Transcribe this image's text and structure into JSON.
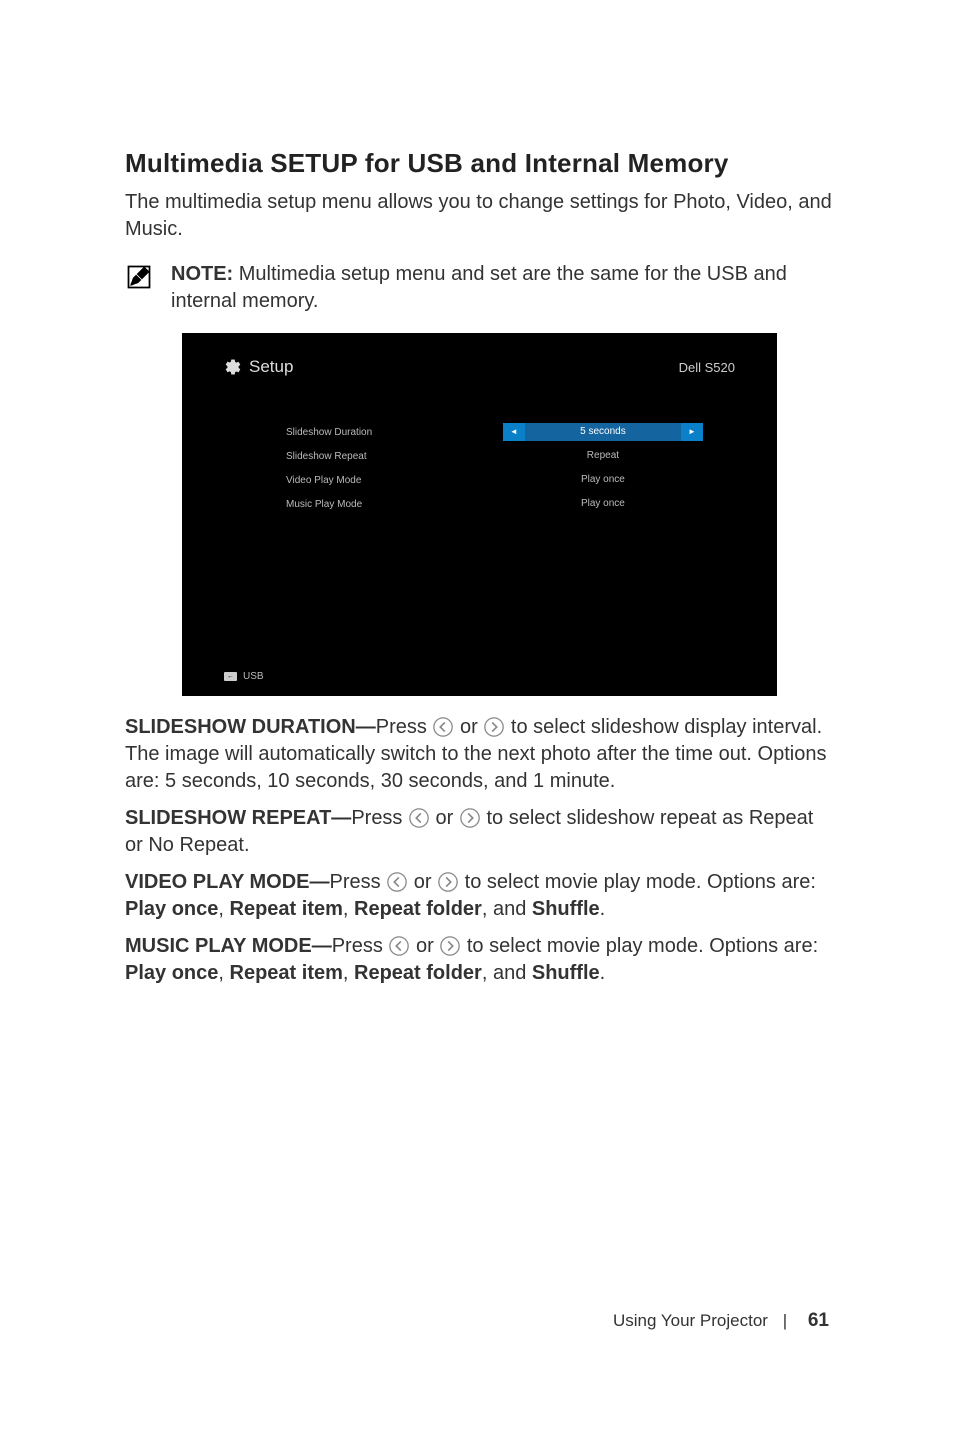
{
  "heading": "Multimedia SETUP for USB and Internal Memory",
  "intro": "The multimedia setup menu allows you to change settings for Photo, Video, and Music.",
  "note": {
    "label": "NOTE:",
    "text": " Multimedia setup menu and set are the same for the USB and internal memory."
  },
  "screen": {
    "title": "Setup",
    "brand": "Dell S520",
    "rows": [
      {
        "label": "Slideshow Duration",
        "value": "5 seconds",
        "selected": true
      },
      {
        "label": "Slideshow Repeat",
        "value": "Repeat",
        "selected": false
      },
      {
        "label": "Video Play Mode",
        "value": "Play once",
        "selected": false
      },
      {
        "label": "Music Play Mode",
        "value": "Play once",
        "selected": false
      }
    ],
    "source_icon": "←",
    "source": "USB"
  },
  "paras": {
    "slideshow_duration": {
      "lead": "SLIDESHOW DURATION—",
      "before": "Press ",
      "mid": " or ",
      "after": " to select slideshow display interval. The image will automatically switch to the next photo after the time out. Options are: 5 seconds, 10 seconds, 30 seconds, and 1 minute."
    },
    "slideshow_repeat": {
      "lead": "SLIDESHOW REPEAT—",
      "before": "Press ",
      "mid": " or ",
      "after": " to select slideshow repeat as Repeat or No Repeat."
    },
    "video_play_mode": {
      "lead": "VIDEO PLAY MODE—",
      "before": "Press ",
      "mid": " or ",
      "after": " to select movie play mode. Options are: ",
      "opts": [
        "Play once",
        "Repeat item",
        "Repeat folder",
        "Shuffle"
      ],
      "joiners": [
        ", ",
        ", ",
        ", and ",
        "."
      ]
    },
    "music_play_mode": {
      "lead": "MUSIC PLAY MODE—",
      "before": "Press ",
      "mid": " or ",
      "after": " to select movie play mode. Options are: ",
      "opts": [
        "Play once",
        "Repeat item",
        "Repeat folder",
        "Shuffle"
      ],
      "joiners": [
        ", ",
        ", ",
        ", and ",
        "."
      ]
    }
  },
  "footer": {
    "section": "Using Your Projector",
    "page": "61"
  }
}
